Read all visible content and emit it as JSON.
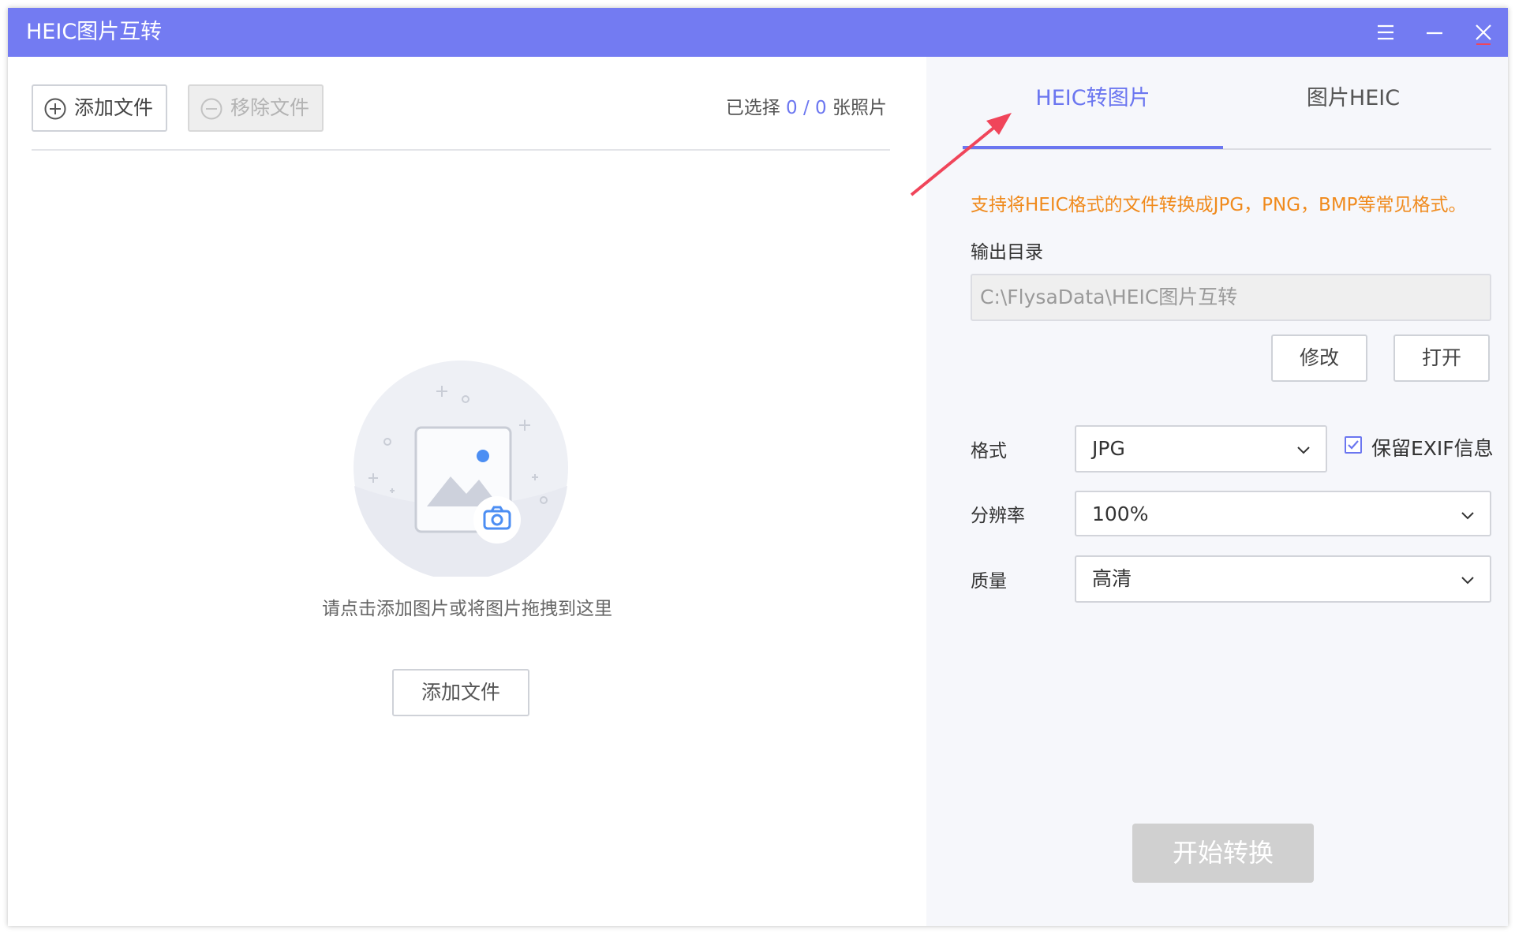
{
  "app": {
    "title": "HEIC图片互转"
  },
  "titlebar": {
    "menu_icon": "menu-icon",
    "minimize_icon": "minimize-icon",
    "close_icon": "close-icon"
  },
  "toolbar": {
    "add_label": "添加文件",
    "remove_label": "移除文件",
    "count_prefix": "已选择",
    "count_selected": "0",
    "count_sep": "/",
    "count_total": "0",
    "count_suffix": "张照片"
  },
  "dropzone": {
    "hint": "请点击添加图片或将图片拖拽到这里",
    "add_label": "添加文件"
  },
  "tabs": [
    {
      "label": "HEIC转图片",
      "active": true
    },
    {
      "label": "图片HEIC",
      "active": false
    }
  ],
  "panel": {
    "info": "支持将HEIC格式的文件转换成JPG，PNG，BMP等常见格式。",
    "output_label": "输出目录",
    "output_path": "C:\\FlysaData\\HEIC图片互转",
    "modify_label": "修改",
    "open_label": "打开",
    "format_label": "格式",
    "format_value": "JPG",
    "exif_label": "保留EXIF信息",
    "exif_checked": true,
    "resolution_label": "分辨率",
    "resolution_value": "100%",
    "quality_label": "质量",
    "quality_value": "高清",
    "start_label": "开始转换"
  },
  "colors": {
    "titlebar": "#737bf2",
    "accent": "#6b76f0",
    "info_text": "#f08a1c",
    "annotation_arrow": "#f0455a"
  }
}
